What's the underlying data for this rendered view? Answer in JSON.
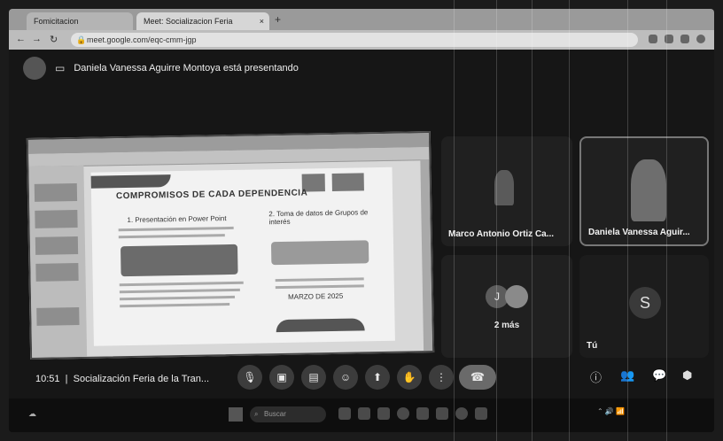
{
  "browser": {
    "tabs": [
      {
        "label": "Fomicitacion"
      },
      {
        "label": "Meet: Socializacion Feria"
      }
    ],
    "url": "meet.google.com/eqc-cmm-jgp",
    "close_glyph": "×",
    "new_tab_glyph": "+"
  },
  "meet": {
    "presenting_text": "Daniela Vanessa Aguirre Montoya está presentando",
    "time": "10:51",
    "meeting_name": "Socialización Feria de la Tran...",
    "participants": [
      {
        "name": "Marco Antonio Ortiz Ca..."
      },
      {
        "name": "Daniela Vanessa Aguir..."
      }
    ],
    "more_label": "2 más",
    "more_avatar": "J",
    "self_label": "Tú",
    "self_avatar": "S"
  },
  "slide": {
    "title": "COMPROMISOS DE CADA DEPENDENCIA",
    "heading_1": "1. Presentación en Power Point",
    "heading_2": "2. Toma de datos de Grupos de interés",
    "footer_date": "MARZO DE 2025"
  },
  "taskbar": {
    "search_placeholder": "Buscar"
  },
  "icons": {
    "mic": "🎙",
    "camera": "▣",
    "captions": "▤",
    "emoji": "☺",
    "present": "⬆",
    "hand": "✋",
    "more": "⋮",
    "hangup": "☎",
    "info": "ⓘ",
    "people": "👥",
    "chat": "💬",
    "activities": "⬢"
  }
}
